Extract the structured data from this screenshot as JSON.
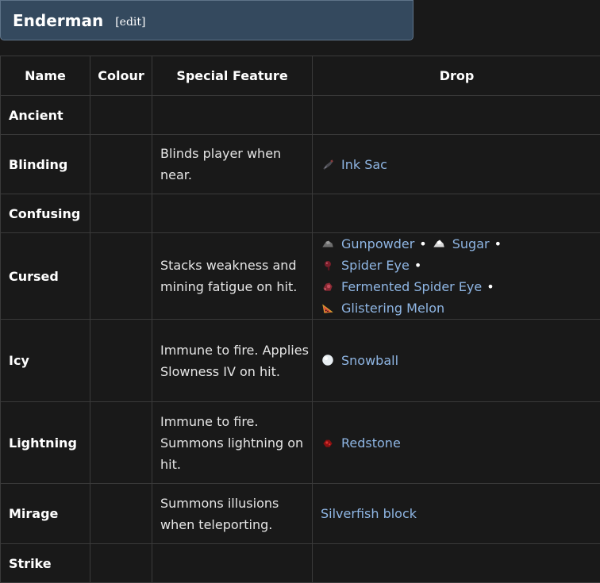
{
  "header": {
    "title": "Enderman",
    "edit_label": "[edit]"
  },
  "table": {
    "columns": [
      "Name",
      "Colour",
      "Special Feature",
      "Drop"
    ],
    "rows": [
      {
        "name": "Ancient",
        "colour": "",
        "feature": "",
        "drops": []
      },
      {
        "name": "Blinding",
        "colour": "",
        "feature": "Blinds player when near.",
        "drops": [
          {
            "label": "Ink Sac",
            "icon": "ink-sac-icon"
          }
        ]
      },
      {
        "name": "Confusing",
        "colour": "",
        "feature": "",
        "drops": []
      },
      {
        "name": "Cursed",
        "colour": "",
        "feature": "Stacks weakness and mining fatigue on hit.",
        "drops": [
          {
            "label": "Gunpowder",
            "icon": "gunpowder-icon"
          },
          {
            "label": "Sugar",
            "icon": "sugar-icon"
          },
          {
            "label": "Spider Eye",
            "icon": "spider-eye-icon"
          },
          {
            "label": "Fermented Spider Eye",
            "icon": "fermented-spider-eye-icon"
          },
          {
            "label": "Glistering Melon",
            "icon": "glistering-melon-icon"
          }
        ]
      },
      {
        "name": "Icy",
        "colour": "",
        "feature": "Immune to fire. Applies Slowness IV on hit.",
        "drops": [
          {
            "label": "Snowball",
            "icon": "snowball-icon"
          }
        ]
      },
      {
        "name": "Lightning",
        "colour": "",
        "feature": "Immune to fire. Summons lightning on hit.",
        "drops": [
          {
            "label": "Redstone",
            "icon": "redstone-icon"
          }
        ]
      },
      {
        "name": "Mirage",
        "colour": "",
        "feature": "Summons illusions when teleporting.",
        "drops": [
          {
            "label": "Silverfish block"
          }
        ]
      },
      {
        "name": "Strike",
        "colour": "",
        "feature": "",
        "drops": []
      }
    ],
    "separator": "•"
  },
  "colors": {
    "link": "#8fb6e4",
    "header_bg": "#34495e",
    "page_bg": "#191919"
  }
}
